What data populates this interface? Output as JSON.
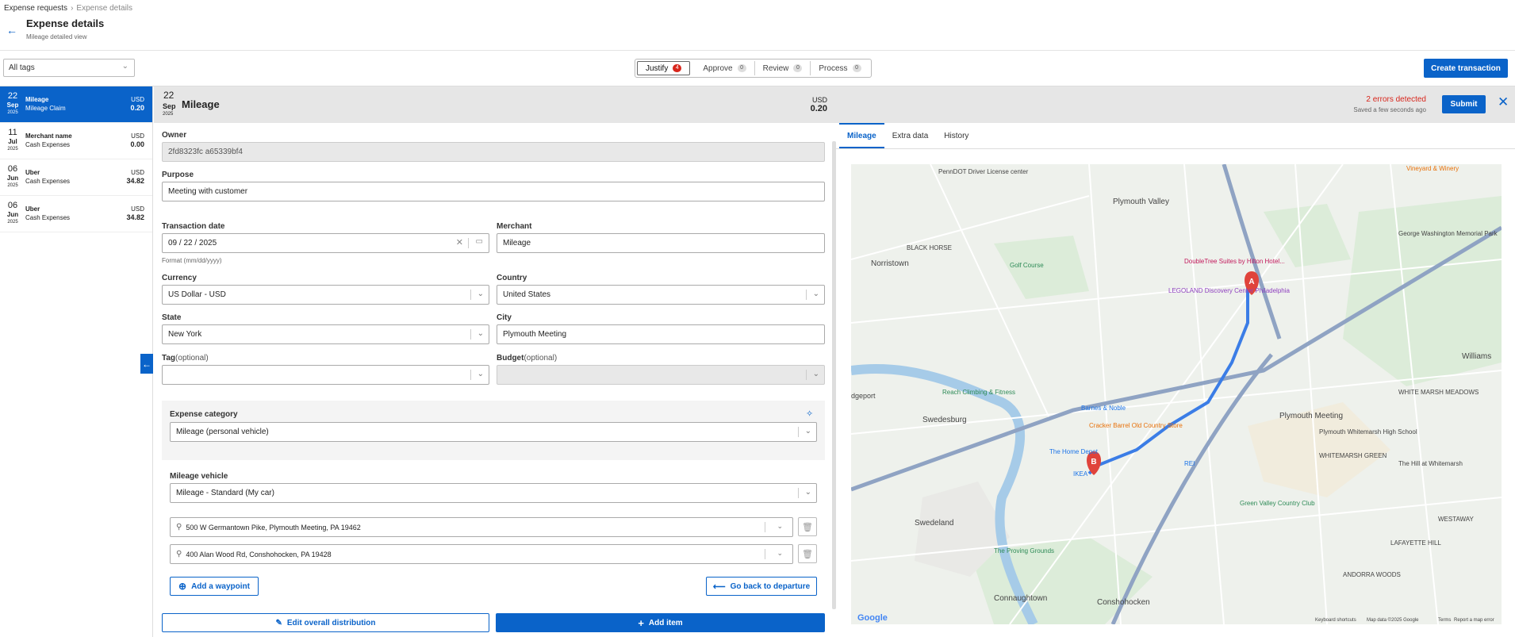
{
  "breadcrumb": {
    "parent": "Expense requests",
    "separator": ">",
    "current": "Expense details"
  },
  "header": {
    "back_icon": "arrow-left-icon",
    "title": "Expense details",
    "subtitle": "Mileage detailed view"
  },
  "toolbar": {
    "tags_value": "All tags",
    "tabs": [
      {
        "label": "Justify",
        "count": "4"
      },
      {
        "label": "Approve",
        "count": "0"
      },
      {
        "label": "Review",
        "count": "0"
      },
      {
        "label": "Process",
        "count": "0"
      }
    ],
    "create_label": "Create transaction"
  },
  "expenses": [
    {
      "day": "22",
      "month": "Sep",
      "year": "2025",
      "title": "Mileage",
      "subtitle": "Mileage Claim",
      "currency": "USD",
      "amount": "0.20"
    },
    {
      "day": "11",
      "month": "Jul",
      "year": "2025",
      "title": "Merchant name",
      "subtitle": "Cash Expenses",
      "currency": "USD",
      "amount": "0.00"
    },
    {
      "day": "06",
      "month": "Jun",
      "year": "2025",
      "title": "Uber",
      "subtitle": "Cash Expenses",
      "currency": "USD",
      "amount": "34.82"
    },
    {
      "day": "06",
      "month": "Jun",
      "year": "2025",
      "title": "Uber",
      "subtitle": "Cash Expenses",
      "currency": "USD",
      "amount": "34.82"
    }
  ],
  "detail": {
    "day": "22",
    "month": "Sep",
    "year": "2025",
    "title": "Mileage",
    "currency": "USD",
    "amount": "0.20",
    "errors": "2 errors detected",
    "saved": "Saved a few seconds ago",
    "submit_label": "Submit"
  },
  "form": {
    "owner_label": "Owner",
    "owner_value": "2fd8323fc a65339bf4",
    "purpose_label": "Purpose",
    "purpose_value": "Meeting with customer",
    "date_label": "Transaction date",
    "date_value": "09 / 22 / 2025",
    "date_hint": "Format (mm/dd/yyyy)",
    "merchant_label": "Merchant",
    "merchant_value": "Mileage",
    "currency_label": "Currency",
    "currency_value": "US Dollar - USD",
    "country_label": "Country",
    "country_value": "United States",
    "state_label": "State",
    "state_value": "New York",
    "city_label": "City",
    "city_value": "Plymouth Meeting",
    "tag_label": "Tag",
    "tag_optional": "(optional)",
    "budget_label": "Budget",
    "budget_optional": "(optional)",
    "category_label": "Expense category",
    "category_value": "Mileage (personal vehicle)",
    "vehicle_label": "Mileage vehicle",
    "vehicle_value": "Mileage - Standard (My car)",
    "waypoints": [
      "500 W Germantown Pike, Plymouth Meeting, PA 19462",
      "400 Alan Wood Rd, Conshohocken, PA 19428"
    ],
    "add_waypoint_label": "Add a waypoint",
    "back_departure_label": "Go back to departure",
    "edit_distribution_label": "Edit overall distribution",
    "add_item_label": "Add item"
  },
  "right_tabs": [
    "Mileage",
    "Extra data",
    "History"
  ],
  "map": {
    "labels": [
      "Plymouth Valley",
      "Norristown",
      "BLACK HORSE",
      "Golf Course",
      "DoubleTree Suites by Hilton Hotel...",
      "LEGOLAND Discovery Center Philadelphia",
      "George Washington Memorial Park",
      "Williams",
      "WHITE MARSH MEADOWS",
      "Plymouth Meeting",
      "Plymouth Whitemarsh High School",
      "WHITEMARSH GREEN",
      "The Hill at Whitemarsh",
      "Reach Climbing & Fitness",
      "Barnes & Noble",
      "Cracker Barrel Old Country Store",
      "The Home Depot",
      "IKEA",
      "REI",
      "Green Valley Country Club",
      "Swedesburg",
      "Swedeland",
      "The Proving Grounds",
      "WESTAWAY",
      "LAFAYETTE HILL",
      "ANDORRA WOODS",
      "Conshohocken",
      "Connaughtown",
      "Google",
      "PennDOT Driver License center",
      "Vineyard & Winery",
      "dgeport",
      "Keyboard shortcuts",
      "Map data ©2025 Google",
      "Terms",
      "Report a map error"
    ],
    "marker_a": "A",
    "marker_b": "B"
  }
}
